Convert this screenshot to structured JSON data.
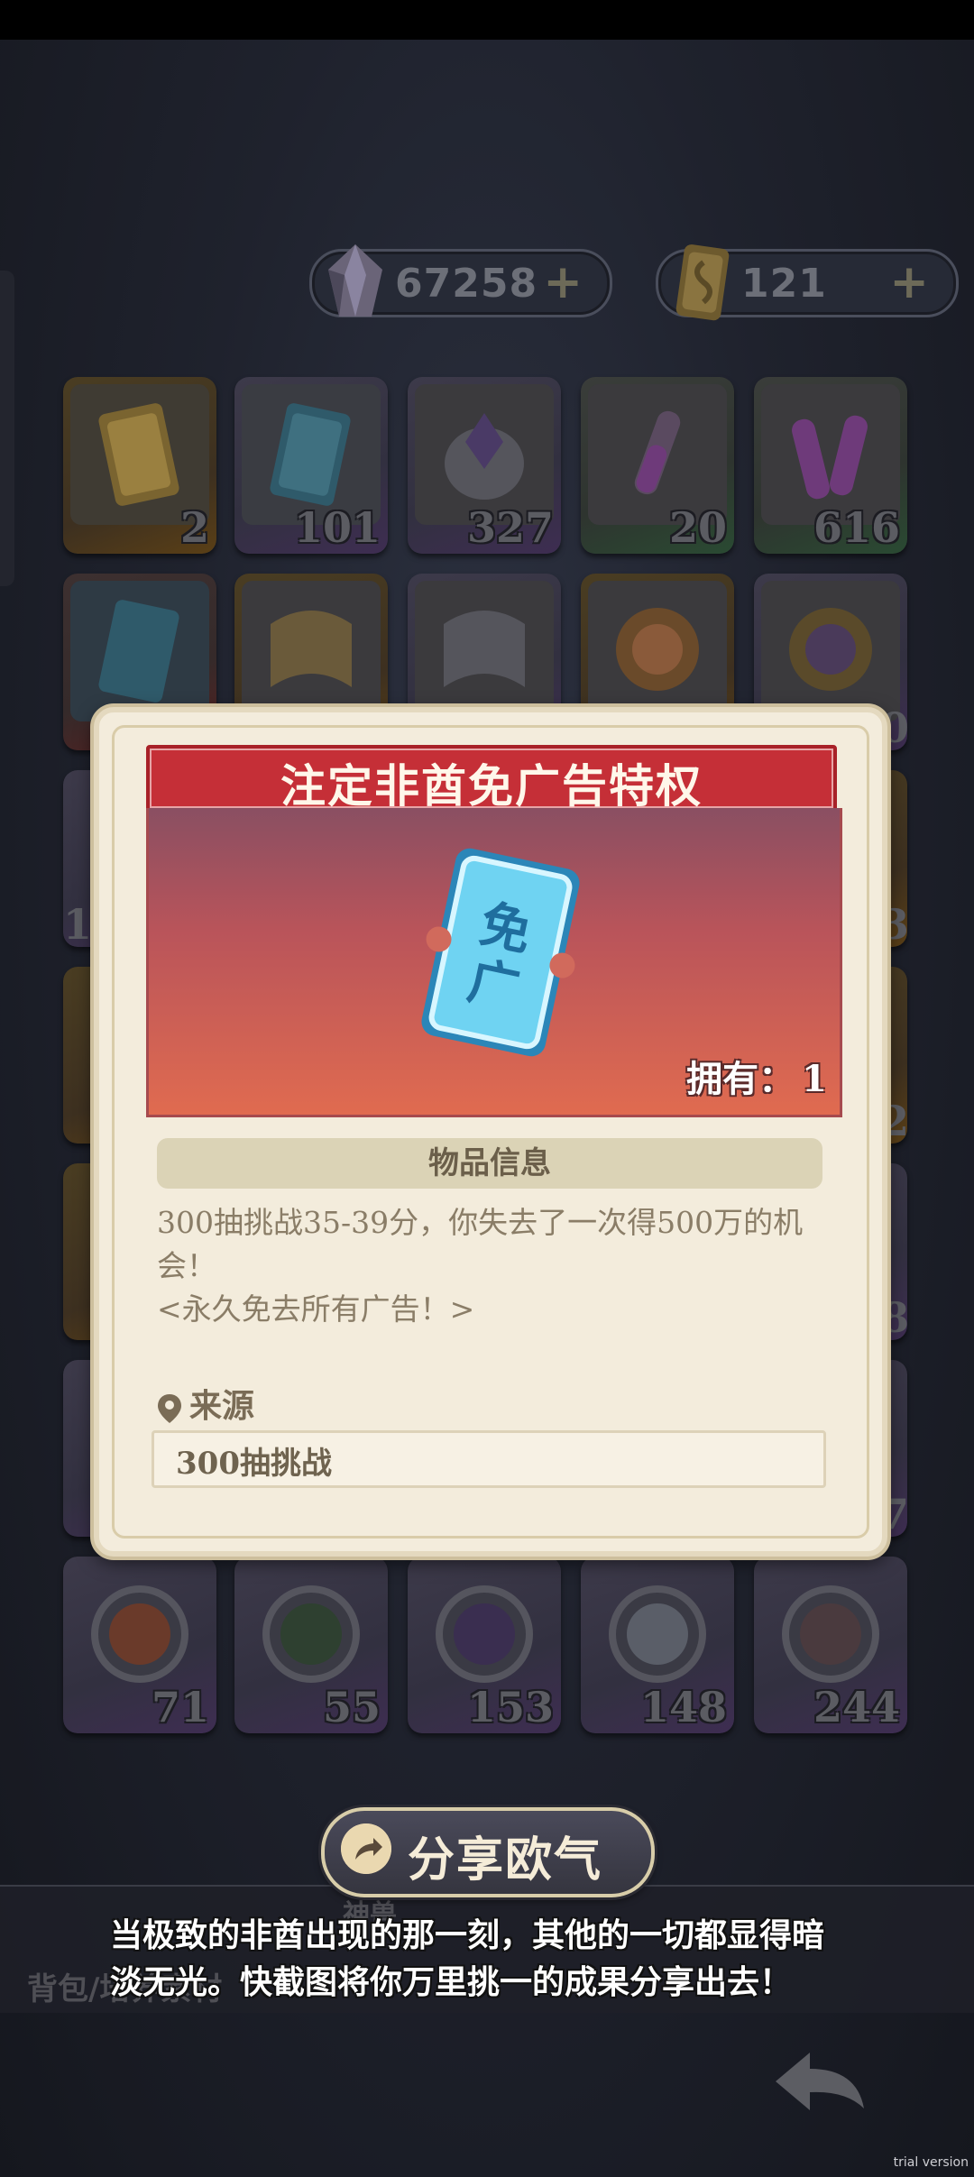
{
  "currency": {
    "gems": {
      "amount": "67258",
      "plus": "+"
    },
    "tickets": {
      "amount": "121",
      "plus": "+"
    }
  },
  "grid": {
    "items": [
      {
        "count": "2",
        "theme": "orange",
        "icon": "ad-free-ticket-gold-icon"
      },
      {
        "count": "101",
        "theme": "purple",
        "icon": "ad-free-ticket-blue-icon"
      },
      {
        "count": "327",
        "theme": "purple",
        "icon": "crystal-egg-icon"
      },
      {
        "count": "20",
        "theme": "green",
        "icon": "potion-vial-icon"
      },
      {
        "count": "616",
        "theme": "green",
        "icon": "twin-potion-icon"
      },
      {
        "count": "",
        "theme": "red",
        "icon": "ad-free-ticket-icon"
      },
      {
        "count": "",
        "theme": "orange",
        "icon": "scroll-gold-icon"
      },
      {
        "count": "",
        "theme": "purple",
        "icon": "scroll-silver-icon"
      },
      {
        "count": "",
        "theme": "orange",
        "icon": "orange-medal-icon"
      },
      {
        "count": "",
        "theme": "purple",
        "icon": "purple-medal-icon"
      }
    ],
    "edge_numbers_left": [
      "1"
    ],
    "edge_numbers_right": [
      "0",
      "3",
      "2",
      "8",
      "7"
    ],
    "bottom_row": [
      {
        "count": "71",
        "icon": "hero-portrait-red-icon"
      },
      {
        "count": "55",
        "icon": "hero-portrait-green-icon"
      },
      {
        "count": "153",
        "icon": "hero-portrait-violet-icon"
      },
      {
        "count": "148",
        "icon": "hero-portrait-white-icon"
      },
      {
        "count": "244",
        "icon": "hero-portrait-dark-icon"
      }
    ]
  },
  "modal": {
    "title": "注定非酋免广告特权",
    "owned_label": "拥有：",
    "owned_count": "1",
    "info_header": "物品信息",
    "description_line1": "300抽挑战35-39分，你失去了一次得500万的机会！",
    "description_line2": "<永久免去所有广告！>",
    "source_label": "来源",
    "source_value": "300抽挑战"
  },
  "share": {
    "button_label": "分享欧气",
    "caption": "当极致的非酋出现的那一刻，其他的一切都显得暗淡无光。快截图将你万里挑一的成果分享出去！"
  },
  "bottom_nav": {
    "bag_tab": "背包/培养素材",
    "beast_tab": "神兽"
  },
  "watermark": "trial version",
  "colors": {
    "modal_bg": "#f3ecdc",
    "banner_red": "#c52f37",
    "info_header_bg": "#dbd3b6",
    "text_brown": "#8a7d67"
  }
}
